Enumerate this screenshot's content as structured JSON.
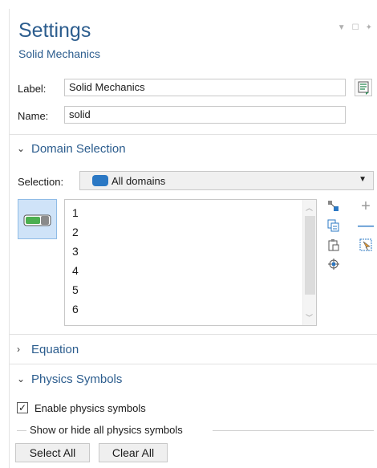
{
  "header": {
    "title": "Settings",
    "subtitle": "Solid Mechanics"
  },
  "fields": {
    "label_caption": "Label:",
    "label_value": "Solid Mechanics",
    "name_caption": "Name:",
    "name_value": "solid"
  },
  "sections": {
    "domain_selection": "Domain Selection",
    "equation": "Equation",
    "physics_symbols": "Physics Symbols"
  },
  "selection": {
    "caption": "Selection:",
    "value": "All domains",
    "items": [
      "1",
      "2",
      "3",
      "4",
      "5",
      "6"
    ]
  },
  "physics": {
    "checkbox_label": "Enable physics symbols",
    "checkbox_checked": true,
    "group_caption": "Show or hide all physics symbols",
    "select_all": "Select All",
    "clear_all": "Clear All"
  },
  "colors": {
    "accent": "#2c5d8e",
    "toggle_green": "#4caf50",
    "selection_icon": "#2b78c4"
  }
}
